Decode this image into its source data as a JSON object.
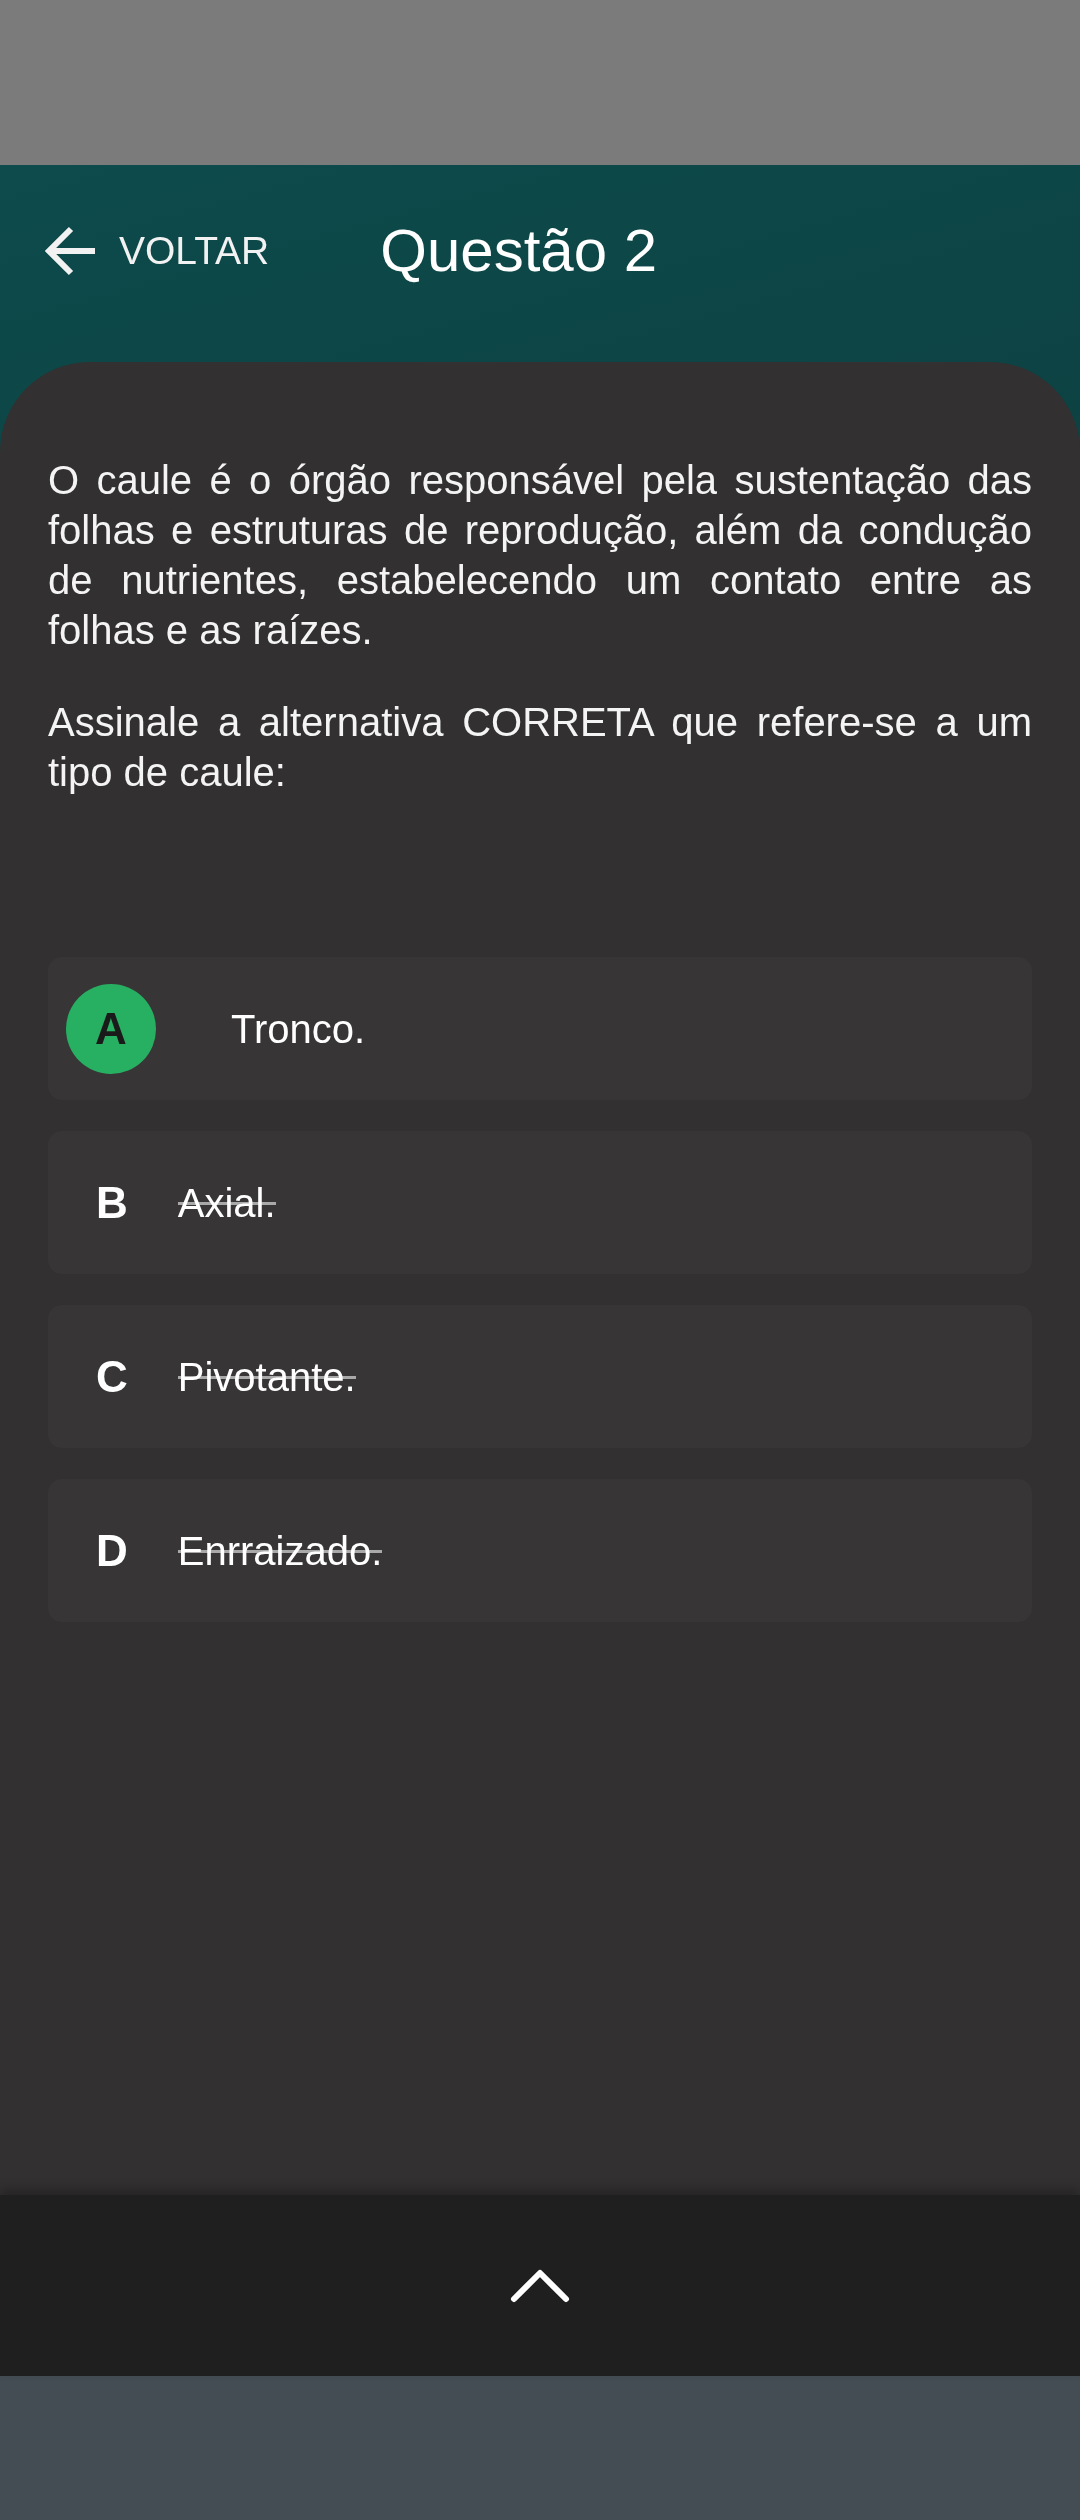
{
  "header": {
    "back_label": "VOLTAR",
    "title": "Questão 2"
  },
  "question": {
    "paragraphs": [
      "O caule é o órgão responsável pela sustentação das folhas e estruturas de reprodução, além da condução de nutrientes, estabelecendo um contato entre as folhas e as raízes.",
      "Assinale a alternativa CORRETA que refere-se a um tipo de caule:"
    ]
  },
  "options": [
    {
      "letter": "A",
      "text": "Tronco.",
      "selected": true,
      "eliminated": false
    },
    {
      "letter": "B",
      "text": "Axial.",
      "selected": false,
      "eliminated": true
    },
    {
      "letter": "C",
      "text": "Pivotante.",
      "selected": false,
      "eliminated": true
    },
    {
      "letter": "D",
      "text": "Enrraizado.",
      "selected": false,
      "eliminated": true
    }
  ]
}
